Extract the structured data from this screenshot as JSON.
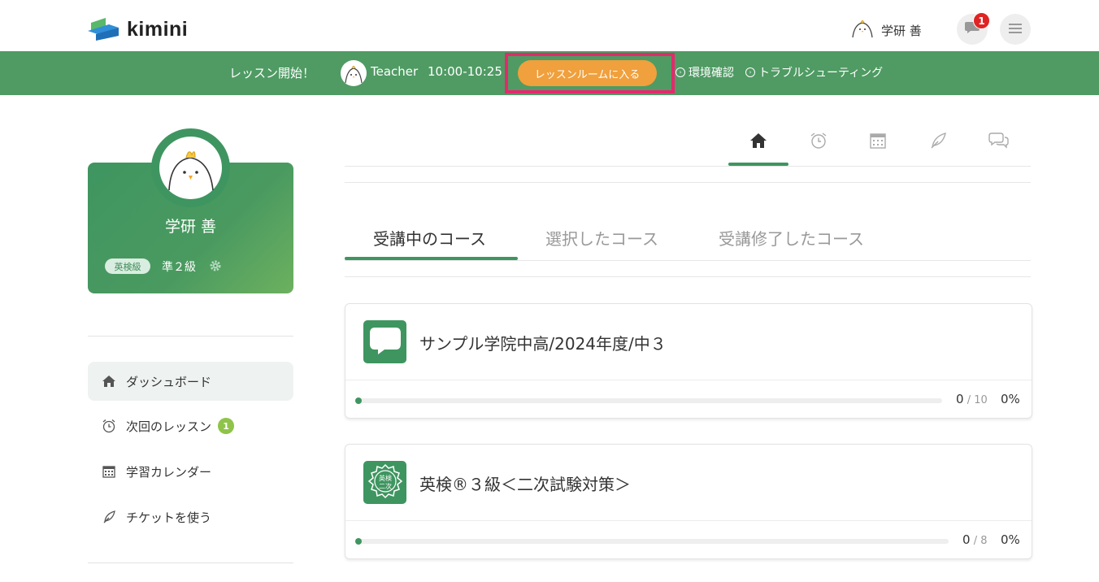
{
  "brand": {
    "name": "kimini",
    "colors": {
      "green": "#4f9b63",
      "accent_orange": "#f0a03c",
      "badge_red": "#e02424",
      "highlight_pink": "#e5296d"
    }
  },
  "header": {
    "user_name": "学研 善",
    "messages_badge": "1",
    "icons": [
      "chick-avatar-icon",
      "chat-bubble-icon",
      "hamburger-menu-icon"
    ]
  },
  "lesson_bar": {
    "start_label": "レッスン開始！",
    "teacher": "Teacher",
    "time": "10:00-10:25",
    "enter_button": "レッスンルームに入る",
    "env_check": "環境確認",
    "troubleshooting": "トラブルシューティング"
  },
  "profile": {
    "name": "学研 善",
    "tag": "英検級",
    "grade": "準２級"
  },
  "sidebar": {
    "items": [
      {
        "label": "ダッシュボード",
        "icon": "home-icon",
        "active": true
      },
      {
        "label": "次回のレッスン",
        "icon": "alarm-clock-icon",
        "badge": "1"
      },
      {
        "label": "学習カレンダー",
        "icon": "calendar-icon"
      },
      {
        "label": "チケットを使う",
        "icon": "feather-icon"
      }
    ]
  },
  "top_tabs": [
    "home-icon",
    "alarm-clock-icon",
    "calendar-icon",
    "feather-icon",
    "chat-icon"
  ],
  "course_tabs": [
    {
      "label": "受講中のコース",
      "active": true
    },
    {
      "label": "選択したコース"
    },
    {
      "label": "受講修了したコース"
    }
  ],
  "courses": [
    {
      "title": "サンプル学院中高/2024年度/中３",
      "done": "0",
      "total": "10",
      "separator": "/",
      "percent": "0%",
      "progress": 0
    },
    {
      "title": "英検®３級＜二次試験対策＞",
      "done": "0",
      "total": "8",
      "separator": "/",
      "percent": "0%",
      "progress": 0,
      "icon_text": [
        "英検",
        "二次"
      ]
    }
  ]
}
